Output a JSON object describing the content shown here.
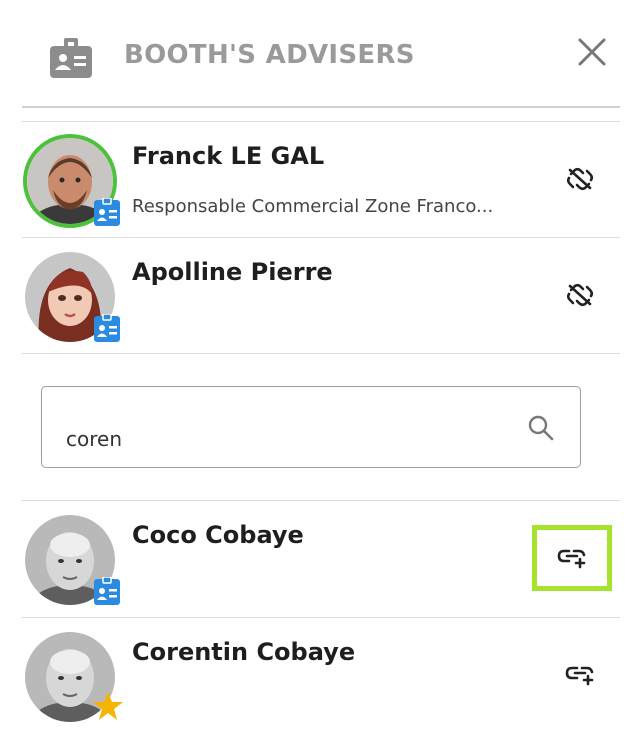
{
  "header": {
    "icon": "id-badge-icon",
    "title": "BOOTH'S ADVISERS",
    "close_icon": "close-icon"
  },
  "advisers": [
    {
      "name": "Franck LE GAL",
      "role": "Responsable Commercial Zone Franco...",
      "badge": "id-badge-icon",
      "status": "online",
      "action_icon": "unlink-icon"
    },
    {
      "name": "Apolline Pierre",
      "role": "",
      "badge": "id-badge-icon",
      "action_icon": "unlink-icon"
    }
  ],
  "search": {
    "value": "coren",
    "icon": "search-icon"
  },
  "results": [
    {
      "name": "Coco Cobaye",
      "badge": "id-badge-icon",
      "action_icon": "add-link-icon",
      "highlighted": true
    },
    {
      "name": "Corentin Cobaye",
      "badge": "star-icon",
      "action_icon": "add-link-icon"
    }
  ],
  "colors": {
    "online_ring": "#4cc23b",
    "badge_blue": "#2a8be0",
    "star": "#f5b400",
    "highlight": "#a6e22e",
    "header_text": "#9a9a9a"
  }
}
